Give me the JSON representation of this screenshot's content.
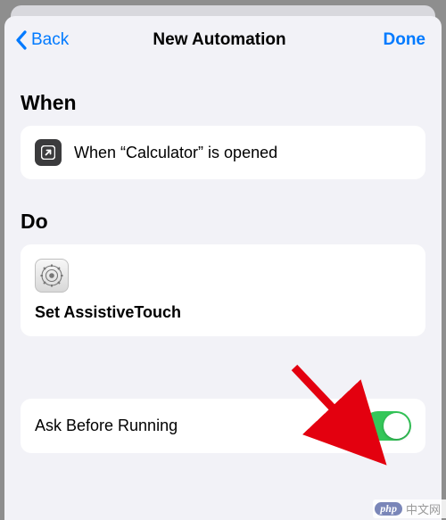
{
  "nav": {
    "back_label": "Back",
    "title": "New Automation",
    "done_label": "Done"
  },
  "sections": {
    "when_header": "When",
    "when_text": "When “Calculator” is opened",
    "do_header": "Do",
    "do_action": "Set AssistiveTouch"
  },
  "ask_row": {
    "label": "Ask Before Running",
    "enabled": true
  },
  "watermark": {
    "php": "php",
    "text": "中文网"
  }
}
